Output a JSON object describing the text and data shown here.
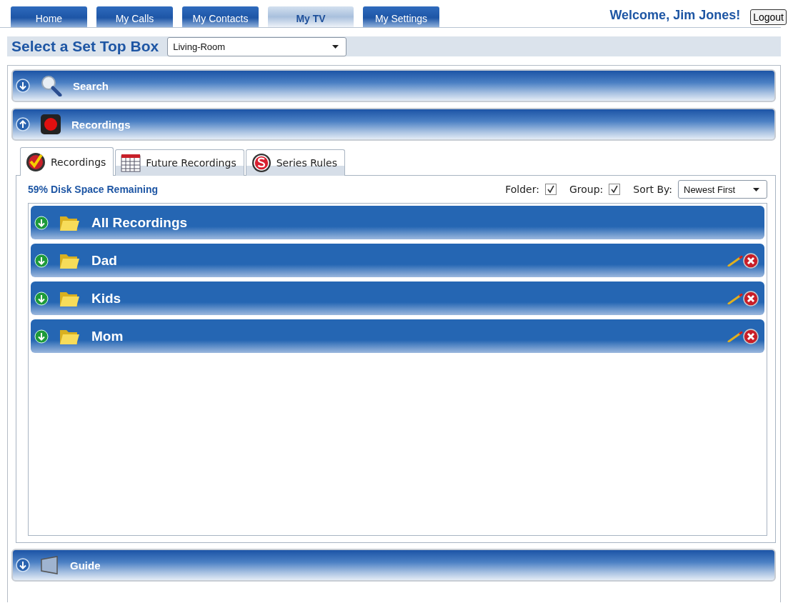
{
  "nav_tabs": [
    {
      "label": "Home",
      "selected": false
    },
    {
      "label": "My Calls",
      "selected": false
    },
    {
      "label": "My Contacts",
      "selected": false
    },
    {
      "label": "My TV",
      "selected": true
    },
    {
      "label": "My Settings",
      "selected": false
    }
  ],
  "welcome": "Welcome, Jim Jones!",
  "logout_button": "Logout",
  "set_top_box": {
    "label": "Select a Set Top Box",
    "value": "Living-Room"
  },
  "sections": [
    {
      "title": "Search",
      "kind": "search",
      "expanded": false
    },
    {
      "title": "Recordings",
      "kind": "recordings",
      "expanded": true,
      "tabs": [
        {
          "label": "Recordings",
          "kind": "recordings",
          "selected": true
        },
        {
          "label": "Future Recordings",
          "kind": "future",
          "selected": false
        },
        {
          "label": "Series Rules",
          "kind": "series",
          "selected": false
        }
      ],
      "disk_space": "59% Disk Space Remaining",
      "filters": [
        {
          "label": "Folder:",
          "checked": true
        },
        {
          "label": "Group:",
          "checked": true
        }
      ],
      "sort": {
        "label": "Sort By:",
        "value": "Newest First"
      },
      "folders": [
        {
          "name": "All Recordings",
          "expanded": false,
          "editable": false
        },
        {
          "name": "Dad",
          "expanded": false,
          "editable": true
        },
        {
          "name": "Kids",
          "expanded": false,
          "editable": true
        },
        {
          "name": "Mom",
          "expanded": false,
          "editable": true
        }
      ]
    },
    {
      "title": "Guide",
      "kind": "guide",
      "expanded": false
    }
  ]
}
